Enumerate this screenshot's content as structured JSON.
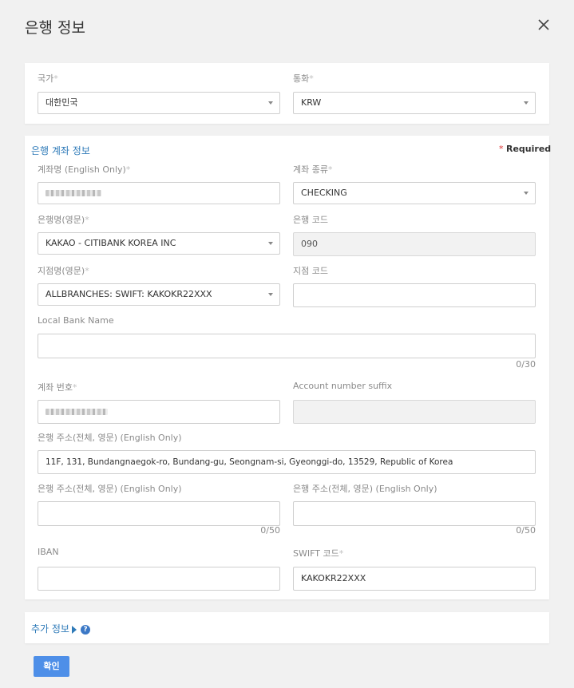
{
  "modal": {
    "title": "은행 정보"
  },
  "country_card": {
    "country_label": "국가",
    "country_value": "대한민국",
    "currency_label": "통화",
    "currency_value": "KRW"
  },
  "bank_card": {
    "section_title": "은행 계좌 정보",
    "required_note": "Required",
    "account_name_label": "계좌명 (English Only)",
    "account_type_label": "계좌 종류",
    "account_type_value": "CHECKING",
    "bank_name_label": "은행명(영문)",
    "bank_name_value": "KAKAO - CITIBANK KOREA INC",
    "bank_code_label": "은행 코드",
    "bank_code_value": "090",
    "branch_name_label": "지점명(영문)",
    "branch_name_value": "ALLBRANCHES: SWIFT: KAKOKR22XXX",
    "branch_code_label": "지점 코드",
    "branch_code_value": "",
    "local_bank_name_label": "Local Bank Name",
    "local_bank_name_value": "",
    "local_bank_name_counter": "0/30",
    "account_number_label": "계좌 번호",
    "account_suffix_label": "Account number suffix",
    "account_suffix_value": "",
    "bank_address1_label": "은행 주소(전체, 영문) (English Only)",
    "bank_address1_value": "11F, 131, Bundangnaegok-ro, Bundang-gu, Seongnam-si, Gyeonggi-do, 13529, Republic of Korea",
    "bank_address2_label": "은행 주소(전체, 영문) (English Only)",
    "bank_address2_value": "",
    "bank_address2_counter": "0/50",
    "bank_address3_label": "은행 주소(전체, 영문) (English Only)",
    "bank_address3_value": "",
    "bank_address3_counter": "0/50",
    "iban_label": "IBAN",
    "iban_value": "",
    "swift_label": "SWIFT 코드",
    "swift_value": "KAKOKR22XXX"
  },
  "extra_card": {
    "title": "추가 정보"
  },
  "footer": {
    "confirm_label": "확인"
  },
  "icons": {
    "close": "close-icon",
    "dropdown": "chevron-down-icon",
    "help": "help-icon",
    "expand": "caret-right-icon"
  },
  "colors": {
    "accent": "#4e8fe8",
    "link": "#2e7ab8",
    "required": "#d33"
  }
}
